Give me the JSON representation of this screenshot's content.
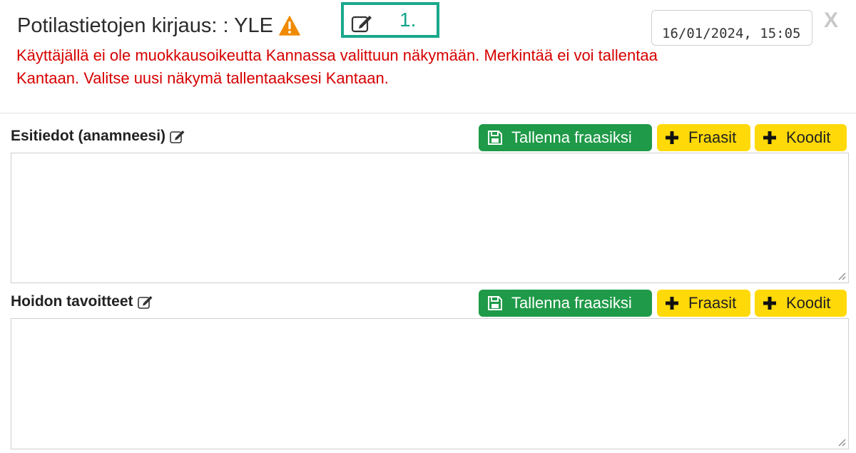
{
  "header": {
    "title": "Potilastietojen kirjaus: : YLE",
    "warning_icon": "warning-triangle-icon",
    "edit_icon": "edit-icon",
    "callout_label": "1.",
    "warning_message": "Käyttäjällä ei ole muokkausoikeutta Kannassa valittuun näkymään. Merkintää ei voi tallentaa Kantaan. Valitse uusi näkymä tallentaaksesi Kantaan.",
    "datetime": "16/01/2024, 15:05",
    "close_label": "X"
  },
  "sections": [
    {
      "label": "Esitiedot (anamneesi)",
      "save_phrase_label": "Tallenna fraasiksi",
      "phrases_label": "Fraasit",
      "codes_label": "Koodit",
      "text": ""
    },
    {
      "label": "Hoidon tavoitteet",
      "save_phrase_label": "Tallenna fraasiksi",
      "phrases_label": "Fraasit",
      "codes_label": "Koodit",
      "text": ""
    }
  ],
  "colors": {
    "warning_text": "#d60000",
    "green_button": "#1f9a48",
    "yellow_button": "#ffd908",
    "callout_border": "#1aa88c",
    "warning_icon": "#f08a00"
  }
}
